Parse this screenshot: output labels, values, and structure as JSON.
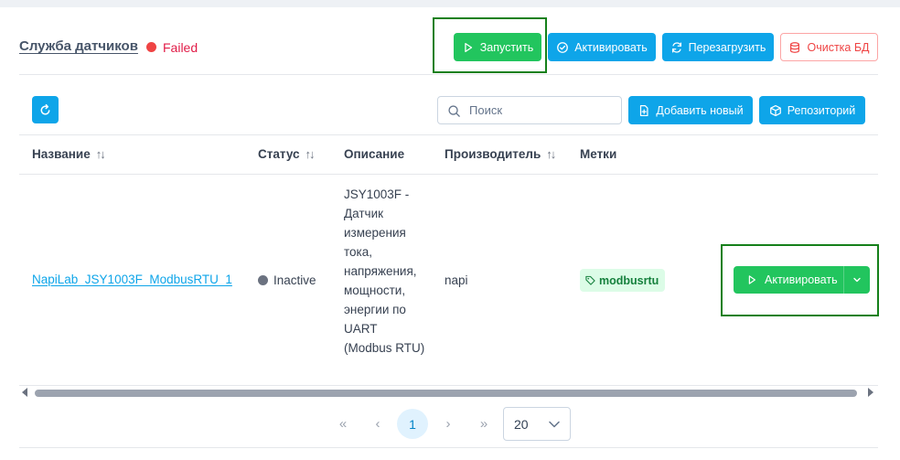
{
  "service": {
    "title": "Служба датчиков",
    "status": "Failed"
  },
  "header_buttons": {
    "start": "Запустить",
    "activate": "Активировать",
    "restart": "Перезагрузить",
    "clear_db": "Очистка БД"
  },
  "toolbar": {
    "search_placeholder": "Поиск",
    "add_new": "Добавить новый",
    "repository": "Репозиторий"
  },
  "table": {
    "columns": {
      "name": "Название",
      "status": "Статус",
      "description": "Описание",
      "vendor": "Производитель",
      "tags": "Метки"
    },
    "rows": [
      {
        "name": "NapiLab_JSY1003F_ModbusRTU_1",
        "status": "Inactive",
        "description": "JSY1003F - Датчик измерения тока, напряжения, мощности, энергии по UART (Modbus RTU)",
        "vendor": "napi",
        "tag": "modbusrtu",
        "action": "Активировать"
      }
    ]
  },
  "pagination": {
    "first": "«",
    "prev": "‹",
    "current": "1",
    "next": "›",
    "last": "»",
    "page_size": "20"
  },
  "colors": {
    "green": "#22c55e",
    "blue": "#0ea5e9",
    "failed": "#e11d48",
    "highlight": "#15801a"
  }
}
